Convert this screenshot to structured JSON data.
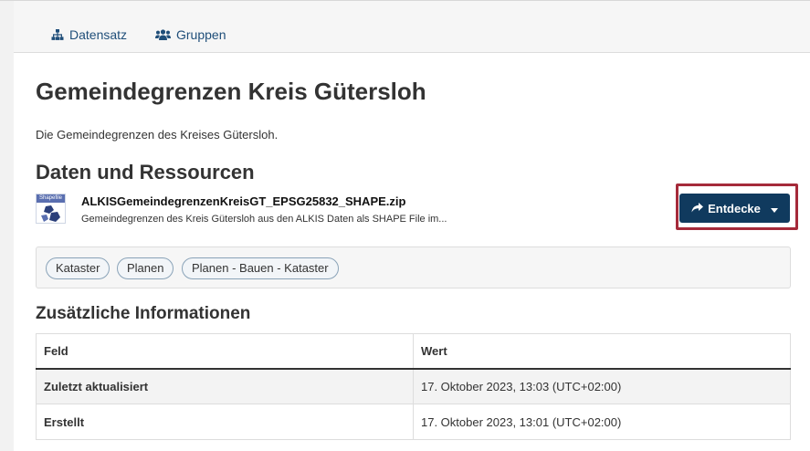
{
  "tabs": [
    {
      "label": "Datensatz",
      "icon": "sitemap-icon"
    },
    {
      "label": "Gruppen",
      "icon": "users-icon"
    }
  ],
  "dataset": {
    "title": "Gemeindegrenzen Kreis Gütersloh",
    "description": "Die Gemeindegrenzen des Kreises Gütersloh."
  },
  "resources": {
    "section_title": "Daten und Ressourcen",
    "items": [
      {
        "icon_badge": "Shapefile",
        "name": "ALKISGemeindegrenzenKreisGT_EPSG25832_SHAPE.zip",
        "description": "Gemeindegrenzen des Kreis Gütersloh aus den ALKIS Daten als SHAPE File im...",
        "explore_label": "Entdecke"
      }
    ]
  },
  "tags": [
    "Kataster",
    "Planen",
    "Planen - Bauen - Kataster"
  ],
  "additional_info": {
    "title": "Zusätzliche Informationen",
    "columns": [
      "Feld",
      "Wert"
    ],
    "rows": [
      [
        "Zuletzt aktualisiert",
        "17. Oktober 2023, 13:03 (UTC+02:00)"
      ],
      [
        "Erstellt",
        "17. Oktober 2023, 13:01 (UTC+02:00)"
      ]
    ]
  },
  "colors": {
    "link": "#1f4e79",
    "primary_button": "#103a5e",
    "highlight_outline": "#a52a3a"
  }
}
